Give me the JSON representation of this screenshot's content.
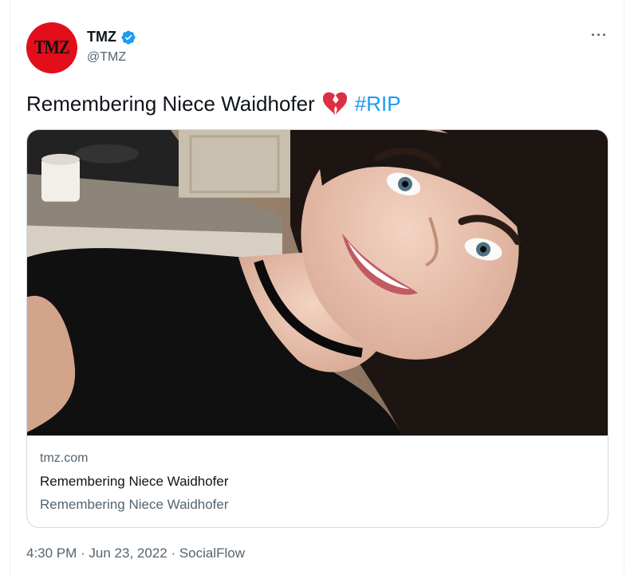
{
  "author": {
    "name": "TMZ",
    "handle": "@TMZ",
    "avatar_text": "TMZ",
    "brand_color": "#e20f1b",
    "verified_icon": "verified-badge-icon"
  },
  "more_label": "···",
  "tweet": {
    "text": "Remembering Niece Waidhofer",
    "emoji_icon": "broken-heart-icon",
    "hashtag": "#RIP"
  },
  "card": {
    "image_icon": "photo-of-smiling-woman",
    "domain": "tmz.com",
    "title": "Remembering Niece Waidhofer",
    "description": "Remembering Niece Waidhofer"
  },
  "meta": {
    "time": "4:30 PM",
    "date": "Jun 23, 2022",
    "source": "SocialFlow"
  },
  "colors": {
    "link": "#1d9bf0",
    "secondary_text": "#536471",
    "border": "#cfd9de"
  }
}
